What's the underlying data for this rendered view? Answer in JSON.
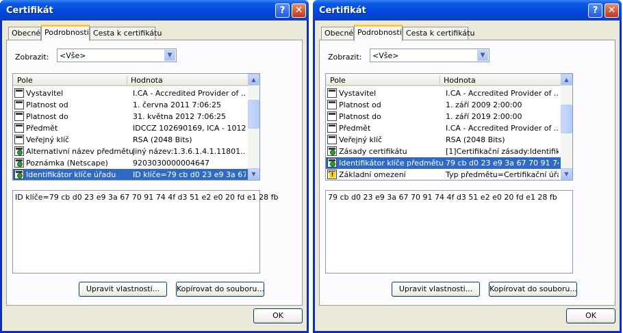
{
  "dialogs": [
    {
      "title": "Certifikát",
      "help_glyph": "?",
      "close_glyph": "✕",
      "tabs": [
        "Obecné",
        "Podrobnosti",
        "Cesta k certifikátu"
      ],
      "show_label": "Zobrazit:",
      "show_value": "<Vše>",
      "columns": [
        "Pole",
        "Hodnota"
      ],
      "rows": [
        {
          "field": "Vystavitel",
          "value": "I.CA - Accredited Provider of ..."
        },
        {
          "field": "Platnost od",
          "value": "1. června 2011 7:06:25"
        },
        {
          "field": "Platnost do",
          "value": "31. května 2012 7:06:25"
        },
        {
          "field": "Předmět",
          "value": "IDCCZ 102690169, ICA - 1012..."
        },
        {
          "field": "Veřejný klíč",
          "value": "RSA (2048 Bits)"
        },
        {
          "field": "Alternativní název předmětu",
          "value": "Jiný název:1.3.6.1.4.1.11801..."
        },
        {
          "field": "Poznámka (Netscape)",
          "value": "9203030000004647"
        },
        {
          "field": "Identifikátor klíče úřadu",
          "value": "ID klíče=79 cb d0 23 e9 3a 67 ..."
        }
      ],
      "selected_index": 7,
      "detail_text": "ID klíče=79 cb d0 23 e9 3a 67 70 91 74 4f d3 51 e2 e0 20 fd e1 28 fb",
      "edit_button": "Upravit vlastnosti...",
      "copy_button": "Kopírovat do souboru...",
      "ok_button": "OK"
    },
    {
      "title": "Certifikát",
      "help_glyph": "?",
      "close_glyph": "✕",
      "tabs": [
        "Obecné",
        "Podrobnosti",
        "Cesta k certifikátu"
      ],
      "show_label": "Zobrazit:",
      "show_value": "<Vše>",
      "columns": [
        "Pole",
        "Hodnota"
      ],
      "rows": [
        {
          "field": "Vystavitel",
          "value": "I.CA - Accredited Provider of ..."
        },
        {
          "field": "Platnost od",
          "value": "1. září 2009 2:00:00"
        },
        {
          "field": "Platnost do",
          "value": "1. září 2019 2:00:00"
        },
        {
          "field": "Předmět",
          "value": "I.CA - Accredited Provider of ..."
        },
        {
          "field": "Veřejný klíč",
          "value": "RSA (2048 Bits)"
        },
        {
          "field": "Zásady certifikátu",
          "value": "[1]Certifikační zásady:Identifik..."
        },
        {
          "field": "Identifikátor klíče předmětu",
          "value": "79 cb d0 23 e9 3a 67 70 91 74..."
        },
        {
          "field": "Základní omezení",
          "value": "Typ předmětu=Certifikační úřa..."
        }
      ],
      "selected_index": 6,
      "detail_text": "79 cb d0 23 e9 3a 67 70 91 74 4f d3 51 e2 e0 20 fd e1 28 fb",
      "edit_button": "Upravit vlastnosti...",
      "copy_button": "Kopírovat do souboru...",
      "ok_button": "OK"
    }
  ],
  "colors": {
    "titlebar": "#0048d8",
    "selection": "#316ac5",
    "tab_highlight": "#ffc83c",
    "dialog_face": "#ece9d8"
  }
}
